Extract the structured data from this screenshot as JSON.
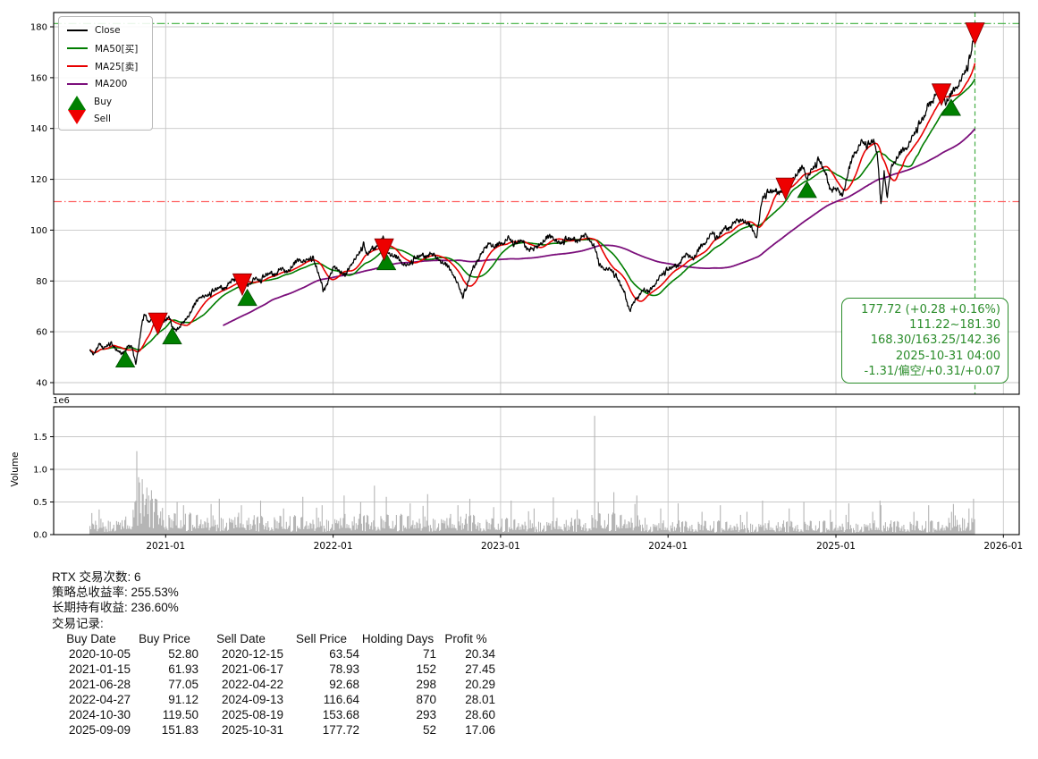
{
  "chart_data": {
    "type": "line",
    "symbol": "RTX",
    "x_axis": {
      "ticks": [
        {
          "label": "2021-01",
          "date": "2021-01-01"
        },
        {
          "label": "2022-01",
          "date": "2022-01-01"
        },
        {
          "label": "2023-01",
          "date": "2023-01-01"
        },
        {
          "label": "2024-01",
          "date": "2024-01-01"
        },
        {
          "label": "2025-01",
          "date": "2025-01-01"
        },
        {
          "label": "2026-01",
          "date": "2026-01-01"
        }
      ],
      "xlim": [
        "2020-05-02",
        "2026-02-04"
      ]
    },
    "y_axis": {
      "ticks": [
        40,
        60,
        80,
        100,
        120,
        140,
        160,
        180
      ],
      "ylim": [
        35.4,
        185.6
      ]
    },
    "grid": true,
    "legend_position": "upper-left",
    "legend": [
      {
        "label": "Close",
        "swatch": "line",
        "color": "#000000"
      },
      {
        "label": "MA50[买]",
        "swatch": "line",
        "color": "#007d00"
      },
      {
        "label": "MA25[卖]",
        "swatch": "line",
        "color": "#e80000"
      },
      {
        "label": "MA200",
        "swatch": "line",
        "color": "#7b0f7b"
      },
      {
        "label": "Buy",
        "swatch": "triangle-up",
        "color": "#008000"
      },
      {
        "label": "Sell",
        "swatch": "triangle-down",
        "color": "#ee0000"
      }
    ],
    "series": {
      "close": {
        "name": "Close",
        "color": "#000000",
        "points": [
          [
            "2020-07-20",
            53
          ],
          [
            "2020-07-28",
            51.5
          ],
          [
            "2020-08-05",
            54.5
          ],
          [
            "2020-08-12",
            55.5
          ],
          [
            "2020-08-20",
            53
          ],
          [
            "2020-09-02",
            54.5
          ],
          [
            "2020-09-14",
            52
          ],
          [
            "2020-09-24",
            51
          ],
          [
            "2020-10-05",
            52.8
          ],
          [
            "2020-10-12",
            54
          ],
          [
            "2020-10-20",
            53
          ],
          [
            "2020-10-28",
            47
          ],
          [
            "2020-11-05",
            56
          ],
          [
            "2020-11-09",
            61.5
          ],
          [
            "2020-11-16",
            66
          ],
          [
            "2020-11-24",
            63
          ],
          [
            "2020-12-04",
            65.5
          ],
          [
            "2020-12-15",
            63.54
          ],
          [
            "2020-12-22",
            62
          ],
          [
            "2020-12-31",
            63
          ],
          [
            "2021-01-08",
            64.8
          ],
          [
            "2021-01-15",
            61.93
          ],
          [
            "2021-01-29",
            60.5
          ],
          [
            "2021-02-10",
            63.5
          ],
          [
            "2021-02-22",
            66.5
          ],
          [
            "2021-03-08",
            70.5
          ],
          [
            "2021-03-18",
            73.5
          ],
          [
            "2021-03-30",
            72.5
          ],
          [
            "2021-04-12",
            74
          ],
          [
            "2021-04-26",
            76
          ],
          [
            "2021-05-10",
            77.5
          ],
          [
            "2021-05-24",
            79
          ],
          [
            "2021-06-04",
            80.5
          ],
          [
            "2021-06-17",
            78.93
          ],
          [
            "2021-06-28",
            77.05
          ],
          [
            "2021-07-12",
            80
          ],
          [
            "2021-07-26",
            78.5
          ],
          [
            "2021-08-09",
            81
          ],
          [
            "2021-08-23",
            82.5
          ],
          [
            "2021-09-08",
            84
          ],
          [
            "2021-09-22",
            83
          ],
          [
            "2021-10-06",
            85.5
          ],
          [
            "2021-10-20",
            87.5
          ],
          [
            "2021-11-03",
            86.5
          ],
          [
            "2021-11-17",
            87.5
          ],
          [
            "2021-12-01",
            81
          ],
          [
            "2021-12-10",
            76
          ],
          [
            "2021-12-20",
            79.5
          ],
          [
            "2022-01-04",
            85
          ],
          [
            "2022-01-18",
            83
          ],
          [
            "2022-01-28",
            81
          ],
          [
            "2022-02-11",
            86.5
          ],
          [
            "2022-02-24",
            88.5
          ],
          [
            "2022-03-08",
            92.5
          ],
          [
            "2022-03-16",
            88.5
          ],
          [
            "2022-03-28",
            92
          ],
          [
            "2022-04-08",
            94.5
          ],
          [
            "2022-04-20",
            96
          ],
          [
            "2022-04-27",
            91.12
          ],
          [
            "2022-05-10",
            89.5
          ],
          [
            "2022-05-24",
            87.5
          ],
          [
            "2022-06-13",
            84.5
          ],
          [
            "2022-06-28",
            87
          ],
          [
            "2022-07-14",
            89
          ],
          [
            "2022-07-28",
            90.5
          ],
          [
            "2022-08-15",
            88.5
          ],
          [
            "2022-09-01",
            86
          ],
          [
            "2022-09-20",
            82
          ],
          [
            "2022-10-10",
            72.5
          ],
          [
            "2022-10-18",
            75
          ],
          [
            "2022-10-26",
            80.5
          ],
          [
            "2022-11-10",
            88
          ],
          [
            "2022-11-25",
            91
          ],
          [
            "2022-12-07",
            94.5
          ],
          [
            "2022-12-20",
            92.5
          ],
          [
            "2023-01-05",
            94
          ],
          [
            "2023-01-18",
            95.5
          ],
          [
            "2023-02-01",
            92.5
          ],
          [
            "2023-02-15",
            94.5
          ],
          [
            "2023-03-01",
            93
          ],
          [
            "2023-03-14",
            91.5
          ],
          [
            "2023-03-28",
            94
          ],
          [
            "2023-04-12",
            96
          ],
          [
            "2023-04-25",
            96.5
          ],
          [
            "2023-05-10",
            93
          ],
          [
            "2023-05-24",
            94.5
          ],
          [
            "2023-06-07",
            95
          ],
          [
            "2023-06-21",
            96.5
          ],
          [
            "2023-07-06",
            97
          ],
          [
            "2023-07-14",
            95.5
          ],
          [
            "2023-07-25",
            93
          ],
          [
            "2023-08-04",
            85
          ],
          [
            "2023-08-18",
            84
          ],
          [
            "2023-09-01",
            82.5
          ],
          [
            "2023-09-15",
            78.5
          ],
          [
            "2023-09-29",
            74
          ],
          [
            "2023-10-10",
            68.5
          ],
          [
            "2023-10-17",
            70.5
          ],
          [
            "2023-10-26",
            72.5
          ],
          [
            "2023-11-08",
            76.5
          ],
          [
            "2023-11-20",
            74.5
          ],
          [
            "2023-12-05",
            78.5
          ],
          [
            "2023-12-18",
            81
          ],
          [
            "2024-01-03",
            83
          ],
          [
            "2024-01-17",
            85
          ],
          [
            "2024-01-29",
            88
          ],
          [
            "2024-02-12",
            89.5
          ],
          [
            "2024-02-26",
            88.5
          ],
          [
            "2024-03-11",
            92
          ],
          [
            "2024-03-25",
            95
          ],
          [
            "2024-04-08",
            97.5
          ],
          [
            "2024-04-17",
            94.5
          ],
          [
            "2024-05-01",
            99
          ],
          [
            "2024-05-15",
            101.5
          ],
          [
            "2024-05-29",
            102.5
          ],
          [
            "2024-06-12",
            103.5
          ],
          [
            "2024-06-26",
            101
          ],
          [
            "2024-07-12",
            96.5
          ],
          [
            "2024-07-25",
            111
          ],
          [
            "2024-08-08",
            113
          ],
          [
            "2024-08-22",
            114
          ],
          [
            "2024-09-05",
            116
          ],
          [
            "2024-09-13",
            116.64
          ],
          [
            "2024-09-25",
            119
          ],
          [
            "2024-10-10",
            121.5
          ],
          [
            "2024-10-22",
            123.5
          ],
          [
            "2024-10-30",
            119.5
          ],
          [
            "2024-11-08",
            121.5
          ],
          [
            "2024-11-25",
            125.5
          ],
          [
            "2024-12-10",
            120.5
          ],
          [
            "2024-12-20",
            116.5
          ],
          [
            "2025-01-06",
            114.5
          ],
          [
            "2025-01-15",
            113
          ],
          [
            "2025-01-28",
            122
          ],
          [
            "2025-02-10",
            129
          ],
          [
            "2025-02-25",
            133
          ],
          [
            "2025-03-12",
            131
          ],
          [
            "2025-03-25",
            133.5
          ],
          [
            "2025-04-03",
            126
          ],
          [
            "2025-04-09",
            110.5
          ],
          [
            "2025-04-16",
            122
          ],
          [
            "2025-04-23",
            111.5
          ],
          [
            "2025-05-01",
            124
          ],
          [
            "2025-05-15",
            128
          ],
          [
            "2025-06-02",
            131
          ],
          [
            "2025-06-16",
            134.5
          ],
          [
            "2025-07-01",
            139
          ],
          [
            "2025-07-15",
            143.5
          ],
          [
            "2025-07-23",
            150
          ],
          [
            "2025-08-05",
            152
          ],
          [
            "2025-08-19",
            153.68
          ],
          [
            "2025-08-28",
            149.5
          ],
          [
            "2025-09-09",
            151.83
          ],
          [
            "2025-09-22",
            155.5
          ],
          [
            "2025-10-03",
            158
          ],
          [
            "2025-10-14",
            161.5
          ],
          [
            "2025-10-21",
            165.5
          ],
          [
            "2025-10-28",
            173
          ],
          [
            "2025-10-30",
            180.3
          ],
          [
            "2025-10-31",
            177.72
          ]
        ]
      },
      "ma25": {
        "name": "MA25[卖]",
        "color": "#e80000",
        "window_days": 36
      },
      "ma50": {
        "name": "MA50[买]",
        "color": "#007d00",
        "window_days": 72
      },
      "ma200": {
        "name": "MA200",
        "color": "#7b0f7b",
        "window_days": 290,
        "visible_after_days": 290
      }
    },
    "hlines": [
      {
        "value": 181.3,
        "color": "#3cb03c",
        "style": "dashdot"
      },
      {
        "value": 111.22,
        "color": "#ff6060",
        "style": "dashdot"
      }
    ],
    "vline": {
      "date": "2025-10-31",
      "color": "#44ad44",
      "style": "dashed"
    },
    "markers": {
      "buy_color": "#008000",
      "buy_edge": "#004d00",
      "sell_color": "#ee0000",
      "sell_edge": "#7d0000"
    },
    "volume": {
      "ylabel": "Volume",
      "offset_label": "1e6",
      "yticks": [
        0.0,
        0.5,
        1.0,
        1.5
      ],
      "bar_color": "#b5b5b5",
      "base_periods": [
        [
          "2020-07-20",
          "2020-10-20",
          0.14
        ],
        [
          "2020-10-20",
          "2020-12-31",
          0.3
        ],
        [
          "2020-12-31",
          "2021-07-01",
          0.17
        ],
        [
          "2021-07-01",
          "2022-01-01",
          0.15
        ],
        [
          "2022-01-01",
          "2022-11-15",
          0.16
        ],
        [
          "2022-11-15",
          "2023-07-15",
          0.13
        ],
        [
          "2023-07-15",
          "2023-11-15",
          0.17
        ],
        [
          "2023-11-15",
          "2025-09-01",
          0.11
        ],
        [
          "2025-09-01",
          "2025-11-01",
          0.17
        ]
      ],
      "spikes": [
        [
          "2020-07-23",
          0.33
        ],
        [
          "2020-10-26",
          0.5
        ],
        [
          "2020-10-29",
          1.28
        ],
        [
          "2020-11-02",
          0.88
        ],
        [
          "2020-11-05",
          0.8
        ],
        [
          "2020-11-10",
          0.85
        ],
        [
          "2020-11-13",
          0.62
        ],
        [
          "2020-11-20",
          0.72
        ],
        [
          "2020-11-24",
          0.6
        ],
        [
          "2020-12-01",
          0.68
        ],
        [
          "2020-12-08",
          0.55
        ],
        [
          "2021-01-26",
          0.5
        ],
        [
          "2021-02-09",
          0.45
        ],
        [
          "2021-04-27",
          0.55
        ],
        [
          "2021-06-15",
          0.45
        ],
        [
          "2021-07-27",
          0.52
        ],
        [
          "2021-09-14",
          0.4
        ],
        [
          "2021-10-26",
          0.58
        ],
        [
          "2021-12-07",
          0.45
        ],
        [
          "2022-01-25",
          0.6
        ],
        [
          "2022-03-01",
          0.5
        ],
        [
          "2022-04-01",
          0.75
        ],
        [
          "2022-04-26",
          0.58
        ],
        [
          "2022-06-17",
          0.48
        ],
        [
          "2022-07-26",
          0.62
        ],
        [
          "2022-09-30",
          0.45
        ],
        [
          "2022-10-25",
          0.55
        ],
        [
          "2022-12-16",
          0.42
        ],
        [
          "2023-01-24",
          0.52
        ],
        [
          "2023-03-15",
          0.4
        ],
        [
          "2023-04-25",
          0.57
        ],
        [
          "2023-06-16",
          0.38
        ],
        [
          "2023-07-25",
          1.82
        ],
        [
          "2023-08-01",
          0.5
        ],
        [
          "2023-09-05",
          0.65
        ],
        [
          "2023-10-24",
          0.6
        ],
        [
          "2023-12-15",
          0.4
        ],
        [
          "2024-01-23",
          0.48
        ],
        [
          "2024-03-15",
          0.35
        ],
        [
          "2024-04-23",
          0.45
        ],
        [
          "2024-06-21",
          0.35
        ],
        [
          "2024-07-25",
          0.52
        ],
        [
          "2024-09-20",
          0.4
        ],
        [
          "2024-10-22",
          0.5
        ],
        [
          "2024-12-20",
          0.38
        ],
        [
          "2025-01-28",
          0.48
        ],
        [
          "2025-03-21",
          0.35
        ],
        [
          "2025-04-07",
          0.52
        ],
        [
          "2025-04-09",
          0.45
        ],
        [
          "2025-06-20",
          0.35
        ],
        [
          "2025-07-22",
          0.45
        ],
        [
          "2025-09-09",
          0.35
        ],
        [
          "2025-10-17",
          0.4
        ],
        [
          "2025-10-28",
          0.55
        ],
        [
          "2025-10-31",
          0.5
        ]
      ]
    },
    "annotation": {
      "color": "#2a8c2a",
      "lines": [
        "177.72 (+0.28 +0.16%)",
        "111.22~181.30",
        "168.30/163.25/142.36",
        "2025-10-31 04:00",
        "-1.31/偏空/+0.31/+0.07"
      ]
    }
  },
  "stats": {
    "line1": "RTX 交易次数: 6",
    "line2": "策略总收益率: 255.53%",
    "line3": "长期持有收益: 236.60%",
    "line4": "交易记录:"
  },
  "trades_table": {
    "headers": [
      "Buy Date",
      "Buy Price",
      "Sell Date",
      "Sell Price",
      "Holding Days",
      "Profit %"
    ],
    "rows": [
      [
        "2020-10-05",
        "52.80",
        "2020-12-15",
        "63.54",
        "71",
        "20.34"
      ],
      [
        "2021-01-15",
        "61.93",
        "2021-06-17",
        "78.93",
        "152",
        "27.45"
      ],
      [
        "2021-06-28",
        "77.05",
        "2022-04-22",
        "92.68",
        "298",
        "20.29"
      ],
      [
        "2022-04-27",
        "91.12",
        "2024-09-13",
        "116.64",
        "870",
        "28.01"
      ],
      [
        "2024-10-30",
        "119.50",
        "2025-08-19",
        "153.68",
        "293",
        "28.60"
      ],
      [
        "2025-09-09",
        "151.83",
        "2025-10-31",
        "177.72",
        "52",
        "17.06"
      ]
    ]
  }
}
